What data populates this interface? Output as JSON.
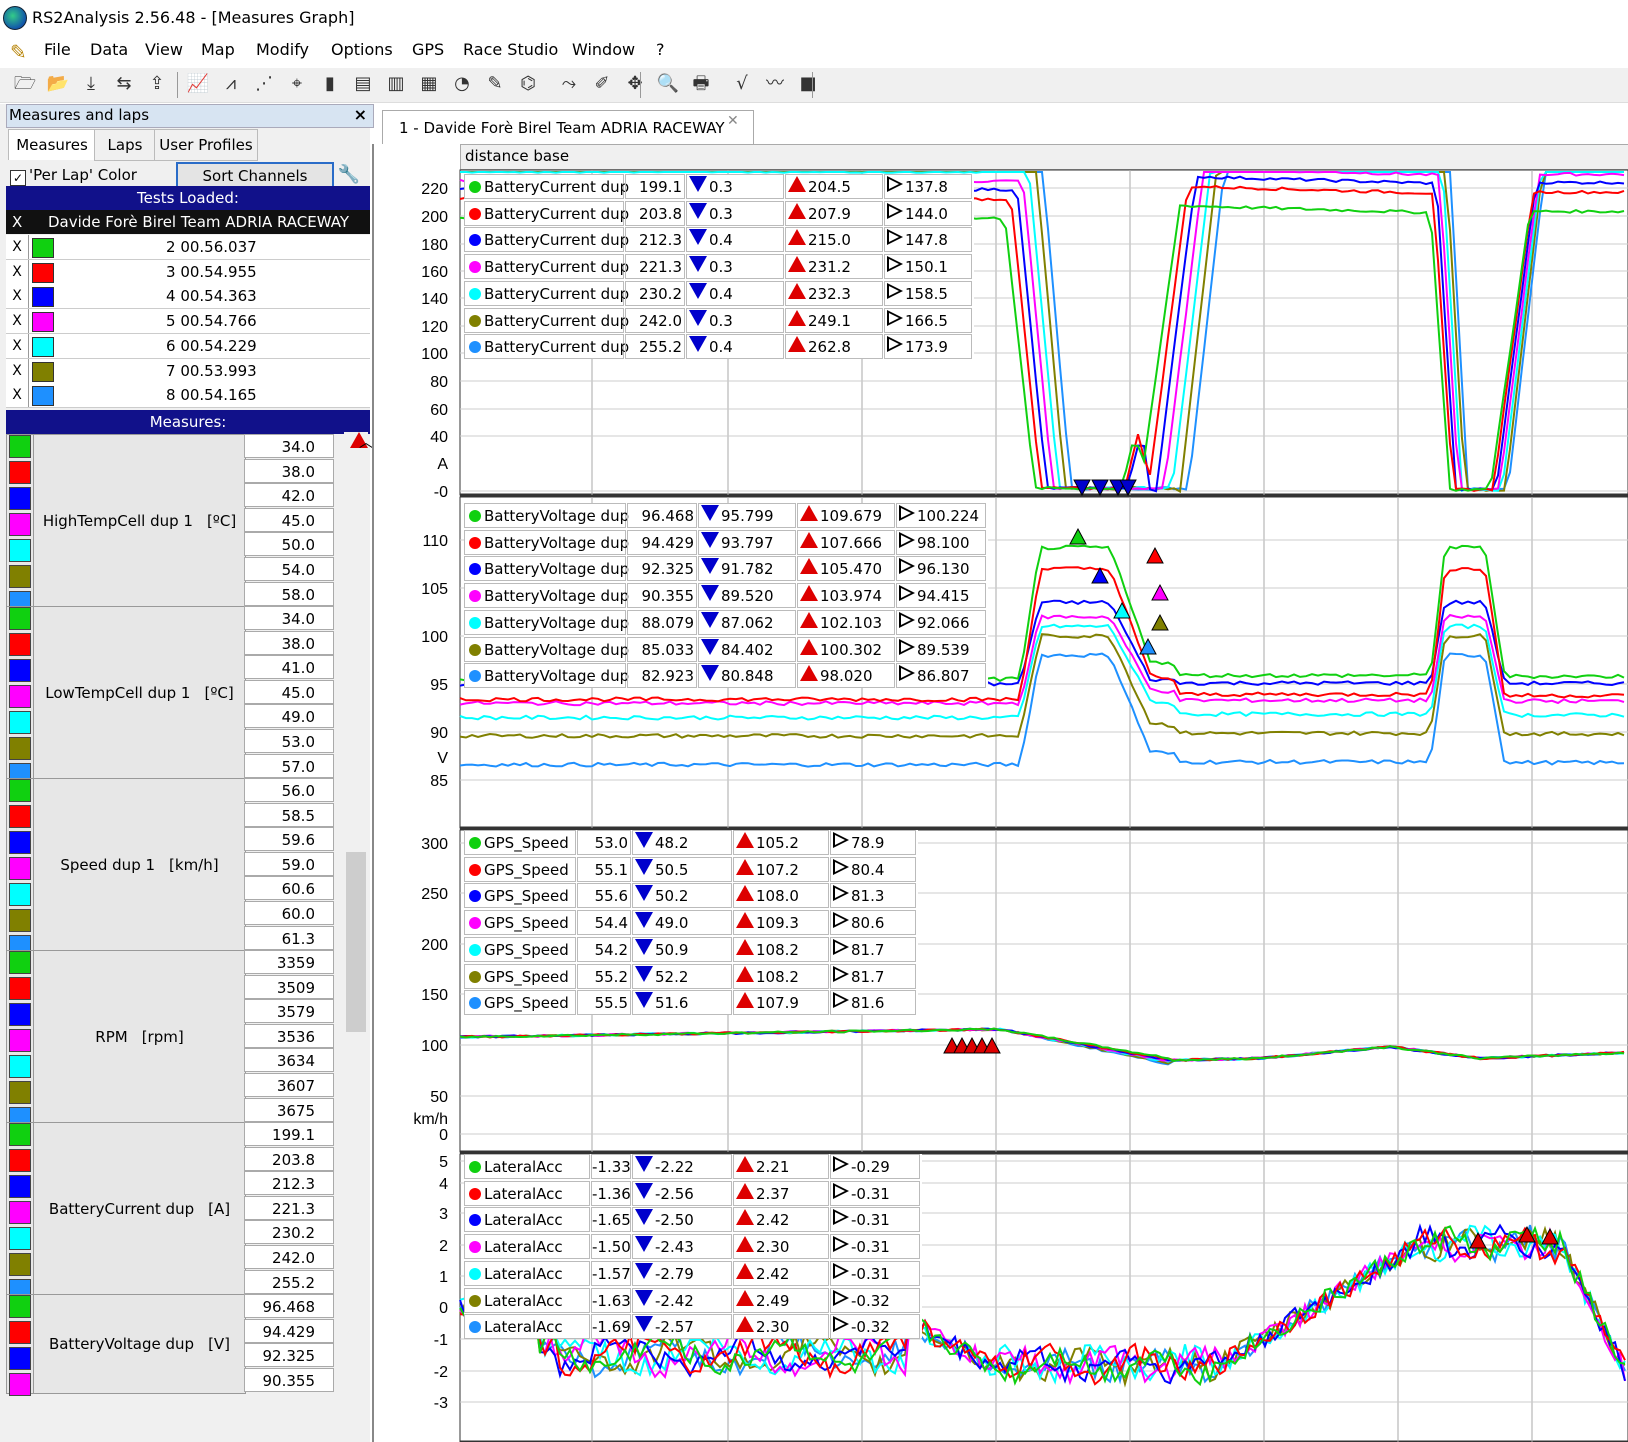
{
  "window": {
    "title": "RS2Analysis 2.56.48 - [Measures Graph]"
  },
  "menu": [
    "File",
    "Data",
    "View",
    "Map",
    "Modify",
    "Options",
    "GPS",
    "Race Studio",
    "Window",
    "?"
  ],
  "toolbar": {
    "icons": [
      "open-icon",
      "open-folder-icon",
      "download-icon",
      "import-icon",
      "export-icon",
      "measures-graph-icon",
      "histogram-icon",
      "scatter-icon",
      "gps-icon",
      "channels-report-icon",
      "report-icon",
      "split-report-icon",
      "bar-icon",
      "gauge-icon",
      "ruler-icon",
      "cursor-icon",
      "track-icon",
      "edit-icon",
      "map-icon",
      "zoom-icon",
      "print-icon",
      "math-icon",
      "compare-icon",
      "exit-icon"
    ]
  },
  "left_panel": {
    "header": "Measures and laps",
    "close": "×",
    "tabs": [
      "Measures",
      "Laps",
      "User Profiles"
    ],
    "per_lap_color": "'Per Lap' Color",
    "sort_button": "Sort Channels",
    "tests_loaded": "Tests Loaded:",
    "test_name": "Davide Forè Birel Team ADRIA RACEWAY",
    "laps": [
      {
        "x": "X",
        "num": "2",
        "time": "00.56.037",
        "color": "#10d010"
      },
      {
        "x": "X",
        "num": "3",
        "time": "00.54.955",
        "color": "#ff0000"
      },
      {
        "x": "X",
        "num": "4",
        "time": "00.54.363",
        "color": "#0000ff"
      },
      {
        "x": "X",
        "num": "5",
        "time": "00.54.766",
        "color": "#ff00ff"
      },
      {
        "x": "X",
        "num": "6",
        "time": "00.54.229",
        "color": "#00ffff"
      },
      {
        "x": "X",
        "num": "7",
        "time": "00.53.993",
        "color": "#808000"
      },
      {
        "x": "X",
        "num": "8",
        "time": "00.54.165",
        "color": "#1e90ff"
      }
    ],
    "measures_header": "Measures:",
    "measures": [
      {
        "name": "HighTempCell dup 1",
        "unit": "[ºC]",
        "values": [
          "34.0",
          "38.0",
          "42.0",
          "45.0",
          "50.0",
          "54.0",
          "58.0"
        ]
      },
      {
        "name": "LowTempCell dup 1",
        "unit": "[ºC]",
        "values": [
          "34.0",
          "38.0",
          "41.0",
          "45.0",
          "49.0",
          "53.0",
          "57.0"
        ]
      },
      {
        "name": "Speed dup 1",
        "unit": "[km/h]",
        "values": [
          "56.0",
          "58.5",
          "59.6",
          "59.0",
          "60.6",
          "60.0",
          "61.3"
        ]
      },
      {
        "name": "RPM",
        "unit": "[rpm]",
        "values": [
          "3359",
          "3509",
          "3579",
          "3536",
          "3634",
          "3607",
          "3675"
        ]
      },
      {
        "name": "BatteryCurrent dup",
        "unit": "[A]",
        "values": [
          "199.1",
          "203.8",
          "212.3",
          "221.3",
          "230.2",
          "242.0",
          "255.2"
        ]
      },
      {
        "name": "BatteryVoltage dup",
        "unit": "[V]",
        "values": [
          "96.468",
          "94.429",
          "92.325",
          "90.355"
        ]
      }
    ]
  },
  "graph": {
    "tab_title": "1 - Davide Forè Birel Team ADRIA RACEWAY",
    "tab_close": "✕",
    "x_axis_label": "distance base",
    "colors": [
      "#10d010",
      "#ff0000",
      "#0000ff",
      "#ff00ff",
      "#00ffff",
      "#808000",
      "#1e90ff"
    ],
    "panels": [
      {
        "unit": "A",
        "ticks": [
          "220",
          "200",
          "180",
          "160",
          "140",
          "120",
          "100",
          "80",
          "60",
          "40",
          "A",
          "-0"
        ],
        "legend": [
          [
            "BatteryCurrent dup",
            "199.1",
            "0.3",
            "204.5",
            "137.8"
          ],
          [
            "BatteryCurrent dup",
            "203.8",
            "0.3",
            "207.9",
            "144.0"
          ],
          [
            "BatteryCurrent dup",
            "212.3",
            "0.4",
            "215.0",
            "147.8"
          ],
          [
            "BatteryCurrent dup",
            "221.3",
            "0.3",
            "231.2",
            "150.1"
          ],
          [
            "BatteryCurrent dup",
            "230.2",
            "0.4",
            "232.3",
            "158.5"
          ],
          [
            "BatteryCurrent dup",
            "242.0",
            "0.3",
            "249.1",
            "166.5"
          ],
          [
            "BatteryCurrent dup",
            "255.2",
            "0.4",
            "262.8",
            "173.9"
          ]
        ]
      },
      {
        "unit": "V",
        "ticks": [
          "110",
          "105",
          "100",
          "95",
          "90",
          "V",
          "85"
        ],
        "legend": [
          [
            "BatteryVoltage dup",
            "96.468",
            "95.799",
            "109.679",
            "100.224"
          ],
          [
            "BatteryVoltage dup",
            "94.429",
            "93.797",
            "107.666",
            "98.100"
          ],
          [
            "BatteryVoltage dup",
            "92.325",
            "91.782",
            "105.470",
            "96.130"
          ],
          [
            "BatteryVoltage dup",
            "90.355",
            "89.520",
            "103.974",
            "94.415"
          ],
          [
            "BatteryVoltage dup",
            "88.079",
            "87.062",
            "102.103",
            "92.066"
          ],
          [
            "BatteryVoltage dup",
            "85.033",
            "84.402",
            "100.302",
            "89.539"
          ],
          [
            "BatteryVoltage dup",
            "82.923",
            "80.848",
            "98.020",
            "86.807"
          ]
        ]
      },
      {
        "unit": "km/h",
        "ticks": [
          "300",
          "250",
          "200",
          "150",
          "100",
          "50",
          "km/h",
          "0"
        ],
        "legend": [
          [
            "GPS_Speed",
            "53.0",
            "48.2",
            "105.2",
            "78.9"
          ],
          [
            "GPS_Speed",
            "55.1",
            "50.5",
            "107.2",
            "80.4"
          ],
          [
            "GPS_Speed",
            "55.6",
            "50.2",
            "108.0",
            "81.3"
          ],
          [
            "GPS_Speed",
            "54.4",
            "49.0",
            "109.3",
            "80.6"
          ],
          [
            "GPS_Speed",
            "54.2",
            "50.9",
            "108.2",
            "81.7"
          ],
          [
            "GPS_Speed",
            "55.2",
            "52.2",
            "108.2",
            "81.7"
          ],
          [
            "GPS_Speed",
            "55.5",
            "51.6",
            "107.9",
            "81.6"
          ]
        ]
      },
      {
        "unit": "",
        "ticks": [
          "5",
          "4",
          "3",
          "2",
          "1",
          "0",
          "-1",
          "-2",
          "-3"
        ],
        "legend": [
          [
            "LateralAcc",
            "-1.33",
            "-2.22",
            "2.21",
            "-0.29"
          ],
          [
            "LateralAcc",
            "-1.36",
            "-2.56",
            "2.37",
            "-0.31"
          ],
          [
            "LateralAcc",
            "-1.65",
            "-2.50",
            "2.42",
            "-0.31"
          ],
          [
            "LateralAcc",
            "-1.50",
            "-2.43",
            "2.30",
            "-0.31"
          ],
          [
            "LateralAcc",
            "-1.57",
            "-2.79",
            "2.42",
            "-0.31"
          ],
          [
            "LateralAcc",
            "-1.63",
            "-2.42",
            "2.49",
            "-0.32"
          ],
          [
            "LateralAcc",
            "-1.69",
            "-2.57",
            "2.30",
            "-0.32"
          ]
        ]
      }
    ]
  }
}
